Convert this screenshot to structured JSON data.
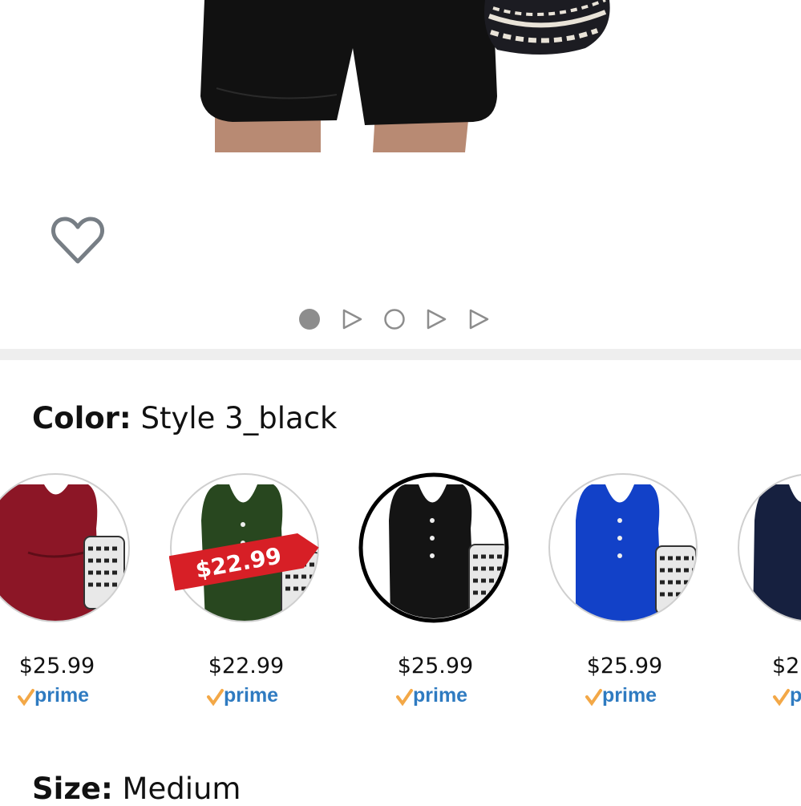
{
  "wishlist": {
    "icon": "heart-outline-icon"
  },
  "carousel": {
    "indicators": [
      "dot-active",
      "play-icon",
      "dot",
      "play-icon",
      "play-icon"
    ]
  },
  "color": {
    "label": "Color:",
    "value": "Style 3_black"
  },
  "swatches": [
    {
      "name": "red",
      "fill": "#8c1626",
      "price": "$25.99",
      "prime": "prime",
      "selected": false
    },
    {
      "name": "green",
      "fill": "#28471f",
      "price": "$22.99",
      "prime": "prime",
      "selected": false,
      "badge": "$22.99"
    },
    {
      "name": "black",
      "fill": "#141414",
      "price": "$25.99",
      "prime": "prime",
      "selected": true
    },
    {
      "name": "blue",
      "fill": "#1241c8",
      "price": "$25.99",
      "prime": "prime",
      "selected": false
    },
    {
      "name": "navy",
      "fill": "#16203f",
      "price": "$2",
      "prime": "p",
      "selected": false
    }
  ],
  "size": {
    "label": "Size:",
    "value": "Medium"
  },
  "colors": {
    "prime_blue": "#2f7bc1",
    "prime_check": "#f3a847",
    "badge_red": "#d71f26",
    "icon_gray": "#777e85"
  }
}
